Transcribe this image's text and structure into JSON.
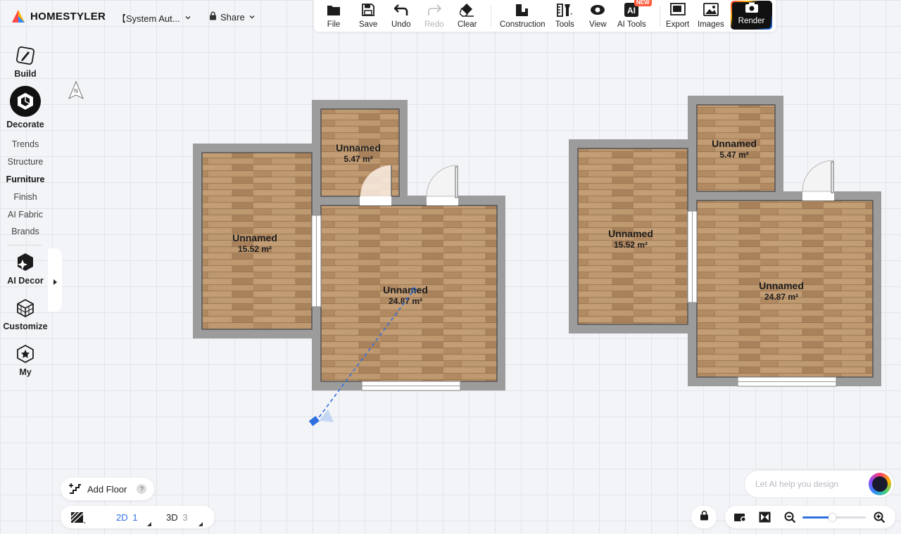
{
  "app": {
    "brand": "HOMESTYLER",
    "document_name": "【System Aut...",
    "share_label": "Share"
  },
  "toolbar": {
    "file": "File",
    "save": "Save",
    "undo": "Undo",
    "redo": "Redo",
    "clear": "Clear",
    "construction": "Construction",
    "tools": "Tools",
    "view": "View",
    "ai_tools": "AI Tools",
    "new_badge": "NEW",
    "export": "Export",
    "images": "Images",
    "render": "Render"
  },
  "sidebar": {
    "build": "Build",
    "decorate": "Decorate",
    "sub_items": [
      "Trends",
      "Structure",
      "Furniture",
      "Finish",
      "AI Fabric",
      "Brands"
    ],
    "active_sub": "Furniture",
    "ai_decor": "AI Decor",
    "customize": "Customize",
    "my": "My"
  },
  "compass": {
    "letter": "N"
  },
  "plan_left": {
    "rooms": [
      {
        "name": "Unnamed",
        "area": "15.52 m²"
      },
      {
        "name": "Unnamed",
        "area": "5.47 m²"
      },
      {
        "name": "Unnamed",
        "area": "24.87 m²"
      }
    ]
  },
  "plan_right": {
    "rooms": [
      {
        "name": "Unnamed",
        "area": "15.52 m²"
      },
      {
        "name": "Unnamed",
        "area": "5.47 m²"
      },
      {
        "name": "Unnamed",
        "area": "24.87 m²"
      }
    ]
  },
  "bottom": {
    "add_floor": "Add Floor",
    "help": "?",
    "view_2d": "2D",
    "view_2d_count": "1",
    "view_3d": "3D",
    "view_3d_count": "3",
    "ai_placeholder": "Let AI help you design",
    "zoom_level_fraction": 0.47
  },
  "colors": {
    "accent_blue": "#2f6fe0",
    "wall_gray": "#9c9c9c",
    "floor_wood": "#b8916a"
  }
}
